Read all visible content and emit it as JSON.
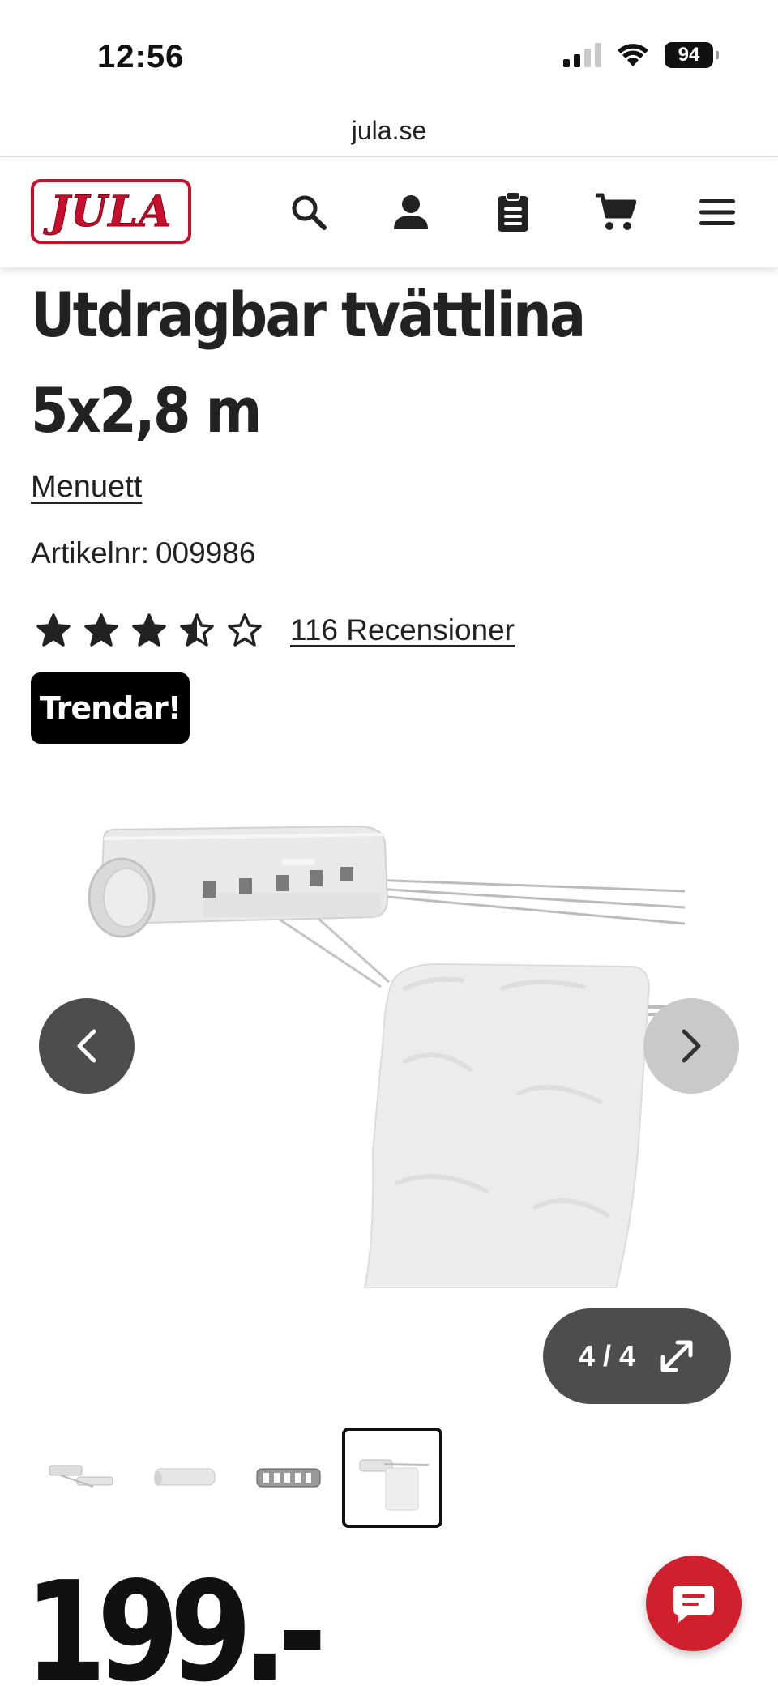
{
  "status_bar": {
    "time": "12:56",
    "battery": "94"
  },
  "browser": {
    "url": "jula.se"
  },
  "header": {
    "logo_text": "JULA",
    "icons": [
      "search-icon",
      "account-icon",
      "shopping-list-icon",
      "cart-icon",
      "menu-icon"
    ]
  },
  "product": {
    "title": "Utdragbar tvättlina 5x2,8 m",
    "brand": "Menuett",
    "article_label": "Artikelnr:",
    "article_number": "009986",
    "rating": 3.5,
    "rating_max": 5,
    "reviews_text": "116 Recensioner",
    "badge": "Trendar!",
    "price": "199.-"
  },
  "gallery": {
    "counter": "4 / 4",
    "current_index": 4,
    "total": 4
  },
  "colors": {
    "brand_red": "#c8102e",
    "chat_red": "#d0202e",
    "dark_gray": "#4d4d4d"
  }
}
